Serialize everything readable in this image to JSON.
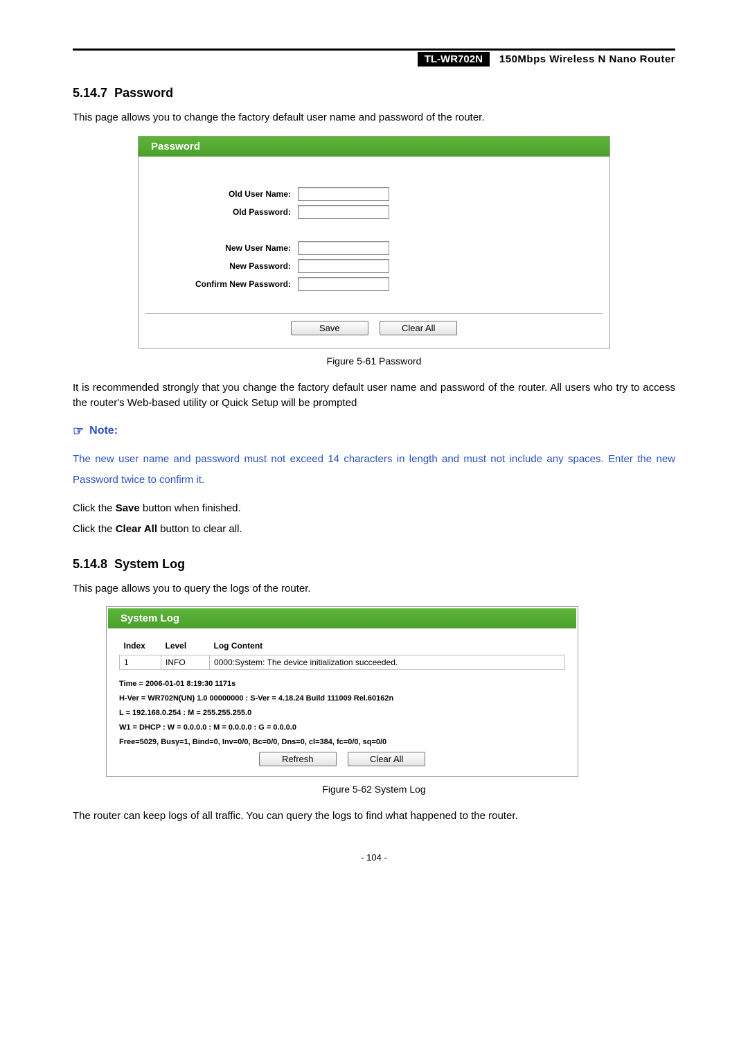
{
  "header": {
    "model": "TL-WR702N",
    "product": "150Mbps Wireless N Nano Router"
  },
  "section1": {
    "num": "5.14.7",
    "title": "Password",
    "intro": "This page allows you to change the factory default user name and password of the router.",
    "panel_title": "Password",
    "labels": {
      "old_user": "Old User Name:",
      "old_pw": "Old Password:",
      "new_user": "New User Name:",
      "new_pw": "New Password:",
      "confirm": "Confirm New Password:"
    },
    "buttons": {
      "save": "Save",
      "clear": "Clear All"
    },
    "caption": "Figure 5-61 Password",
    "para_after": "It is recommended strongly that you change the factory default user name and password of the router. All users who try to access the router's Web-based utility or Quick Setup will be prompted",
    "note_label": "Note:",
    "note_body": "The new user name and password must not exceed 14 characters in length and must not include any spaces. Enter the new Password twice to confirm it.",
    "click_save_pre": "Click the ",
    "click_save_bold": "Save",
    "click_save_post": " button when finished.",
    "click_clear_pre": "Click the ",
    "click_clear_bold": "Clear All",
    "click_clear_post": " button to clear all."
  },
  "section2": {
    "num": "5.14.8",
    "title": "System Log",
    "intro": "This page allows you to query the logs of the router.",
    "panel_title": "System Log",
    "columns": {
      "c1": "Index",
      "c2": "Level",
      "c3": "Log Content"
    },
    "row": {
      "index": "1",
      "level": "INFO",
      "content": "0000:System: The device initialization succeeded."
    },
    "meta": {
      "l1": "Time = 2006-01-01 8:19:30 1171s",
      "l2": "H-Ver = WR702N(UN) 1.0 00000000 : S-Ver = 4.18.24 Build 111009 Rel.60162n",
      "l3": "L = 192.168.0.254 : M = 255.255.255.0",
      "l4": "W1 = DHCP : W = 0.0.0.0 : M = 0.0.0.0 : G = 0.0.0.0",
      "l5": "Free=5029, Busy=1, Bind=0, Inv=0/0, Bc=0/0, Dns=0, cl=384, fc=0/0, sq=0/0"
    },
    "buttons": {
      "refresh": "Refresh",
      "clear": "Clear All"
    },
    "caption": "Figure 5-62 System Log",
    "outro": "The router can keep logs of all traffic. You can query the logs to find what happened to the router."
  },
  "page_number": "- 104 -"
}
